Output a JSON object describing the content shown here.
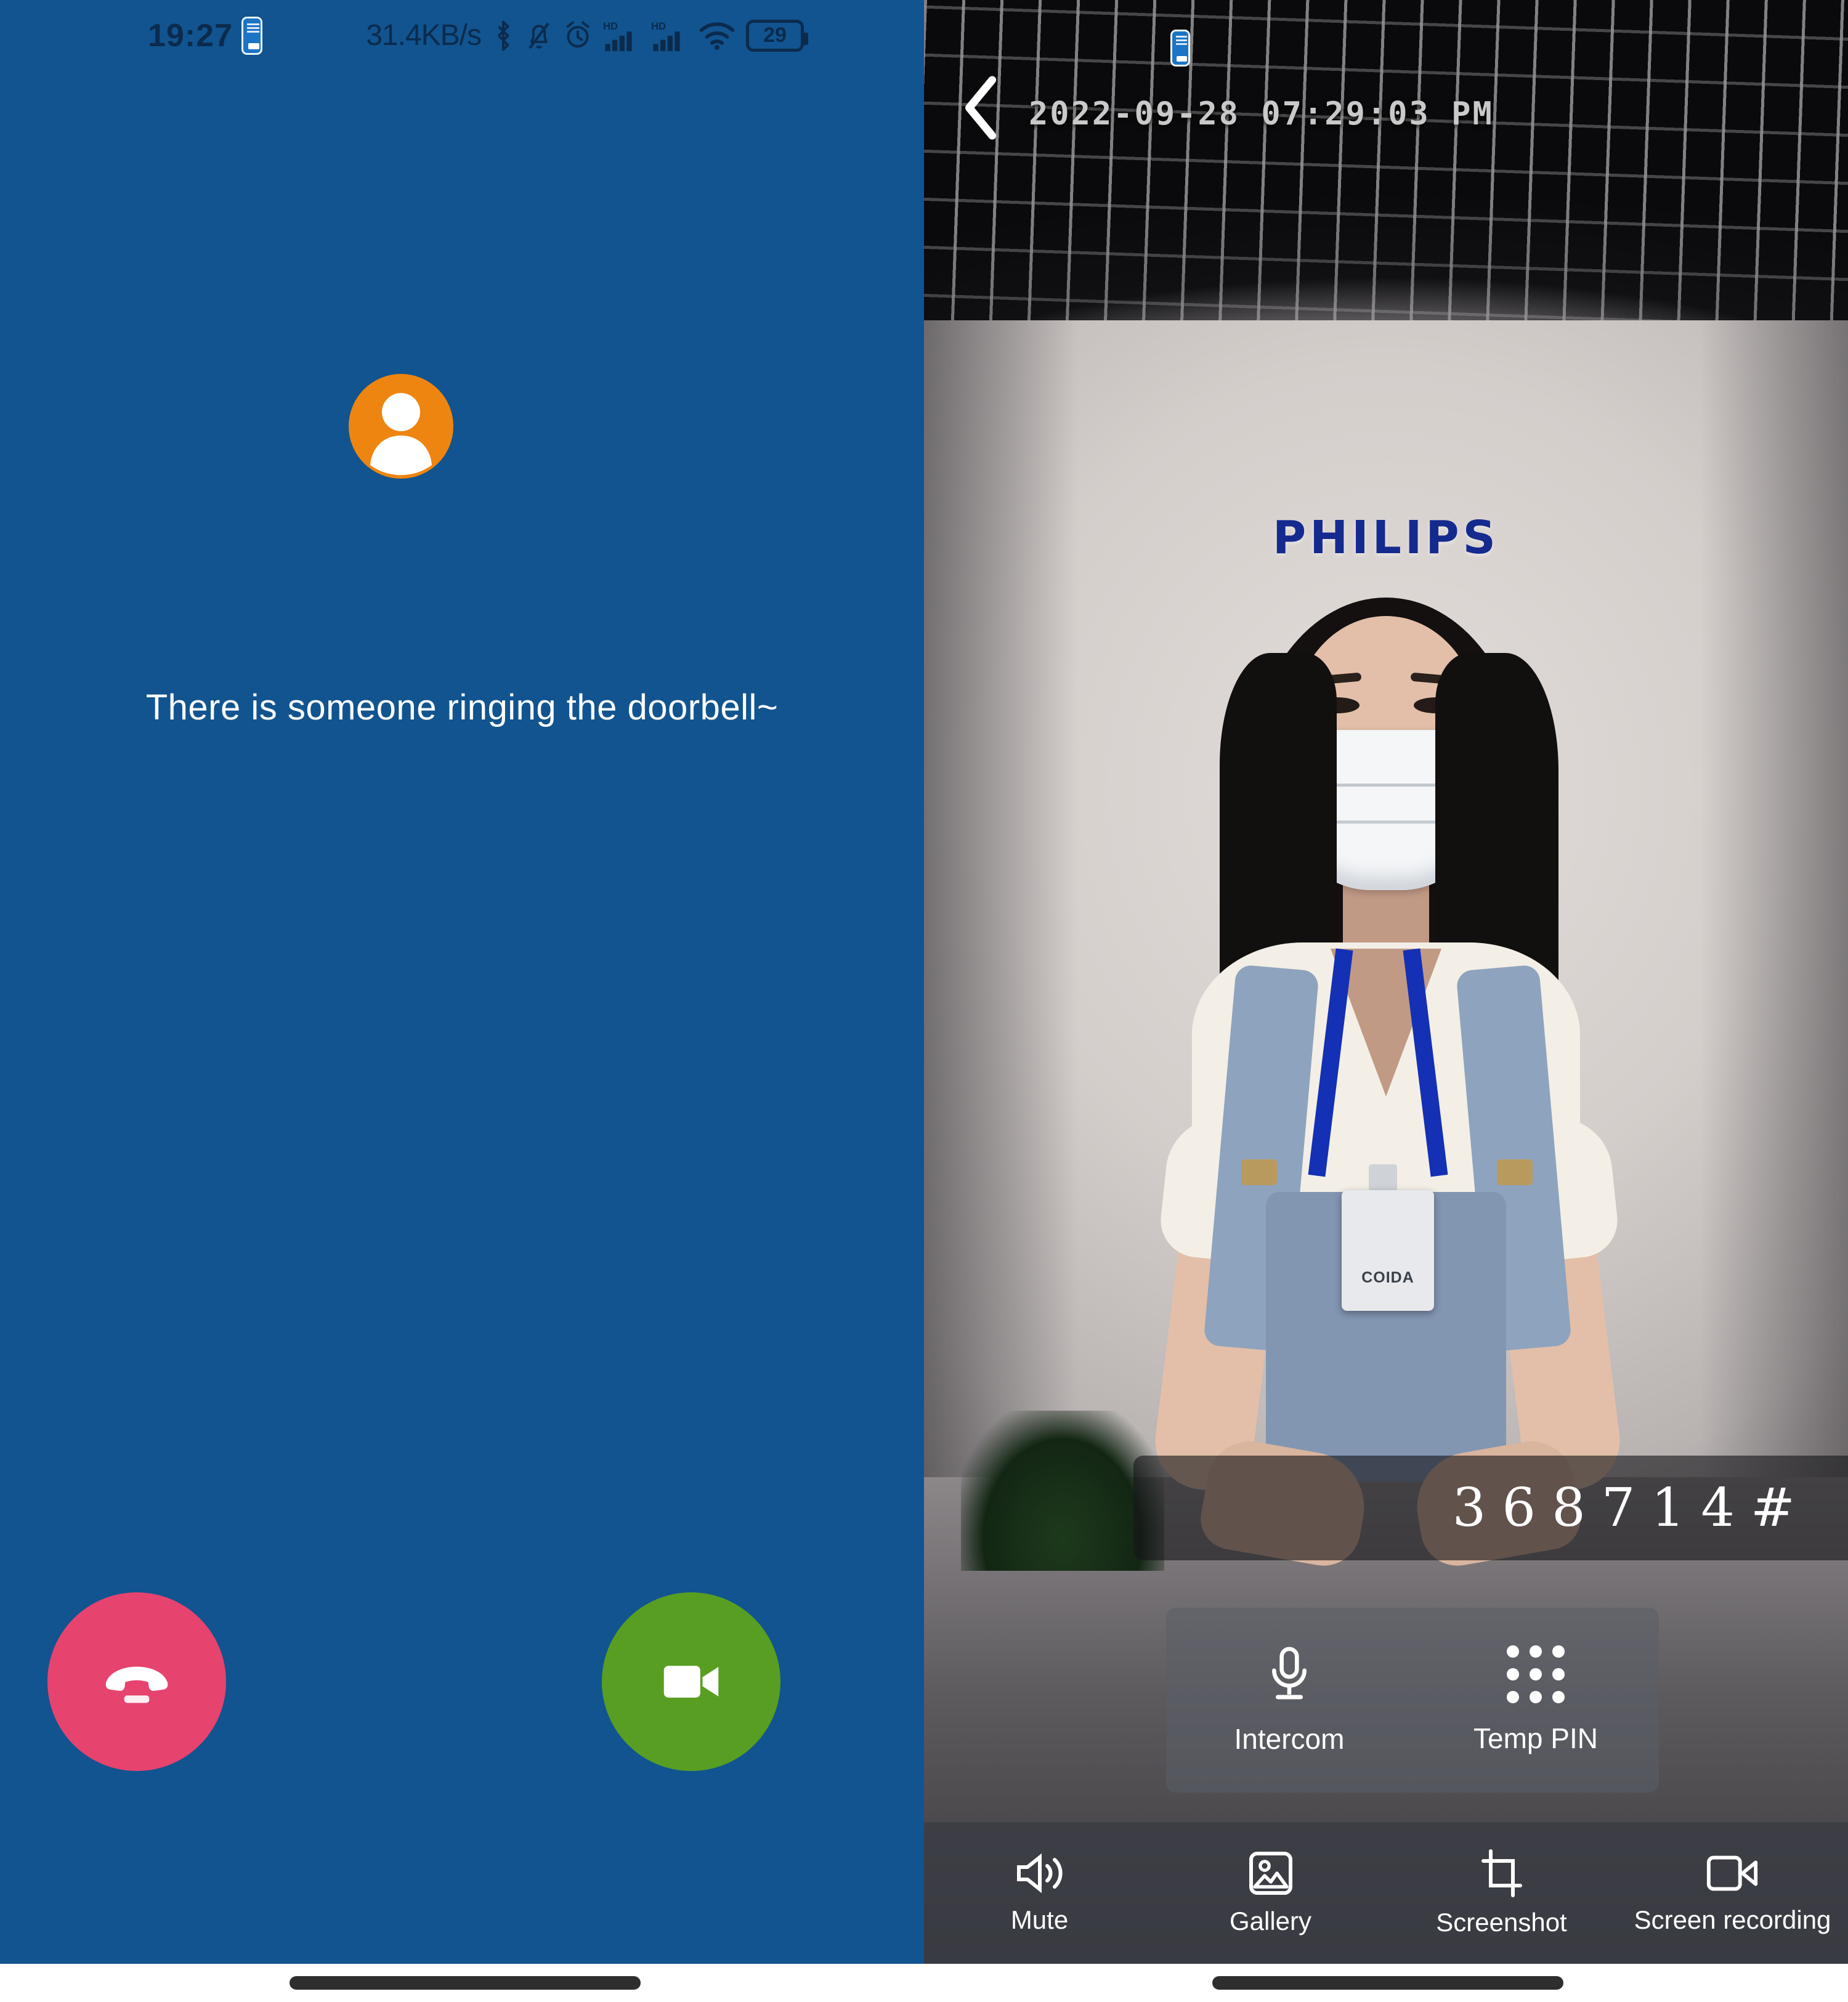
{
  "status_bar": {
    "time": "19:27",
    "app_badge_icon": "doorbell-app-icon",
    "network_speed": "31.4KB/s",
    "icons": [
      "bluetooth-icon",
      "silent-bell-icon",
      "alarm-clock-icon",
      "hd-signal-icon-1",
      "hd-signal-icon-2",
      "wifi-icon"
    ],
    "hd_label": "HD",
    "battery_level": "29"
  },
  "call_screen": {
    "avatar_icon": "person-avatar-icon",
    "avatar_color": "#ee8510",
    "background_color": "#11548f",
    "ringing_text": "There is someone ringing the doorbell~",
    "decline_button": {
      "name": "decline-call",
      "icon": "hangup-phone-icon",
      "color": "#e6436f"
    },
    "answer_button": {
      "name": "answer-call",
      "icon": "video-camera-icon",
      "color": "#589e23"
    }
  },
  "video_screen": {
    "back_icon": "back-chevron-icon",
    "app_badge_icon": "doorbell-app-icon",
    "timestamp": "2022-09-28 07:29:03 PM",
    "wall_brand_text": "PHILIPS",
    "badge_text": "COIDA",
    "pin_display": "368714#",
    "quick_actions": [
      {
        "label": "Intercom",
        "icon": "microphone-icon"
      },
      {
        "label": "Temp PIN",
        "icon": "keypad-grid-icon"
      }
    ],
    "toolbar": [
      {
        "label": "Mute",
        "icon": "speaker-wave-icon"
      },
      {
        "label": "Gallery",
        "icon": "photo-gallery-icon"
      },
      {
        "label": "Screenshot",
        "icon": "crop-frame-icon"
      },
      {
        "label": "Screen recording",
        "icon": "video-record-icon"
      }
    ]
  }
}
